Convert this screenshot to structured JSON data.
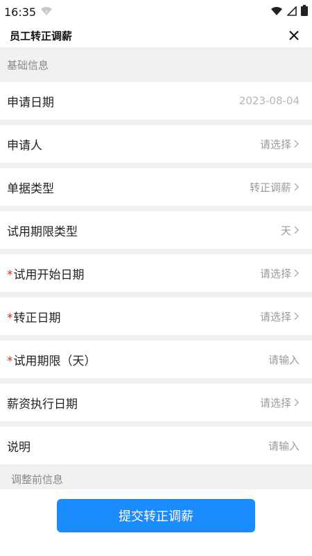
{
  "status_bar": {
    "time": "16:35",
    "icons": [
      "wifi-question-icon",
      "wifi-icon",
      "signal-icon",
      "battery-icon"
    ]
  },
  "header": {
    "title": "员工转正调薪",
    "close_icon": "close-icon"
  },
  "section_basic": {
    "title": "基础信息"
  },
  "fields": [
    {
      "label": "申请日期",
      "required": false,
      "value": "2023-08-04",
      "chevron": false
    },
    {
      "label": "申请人",
      "required": false,
      "value": "请选择",
      "chevron": true
    },
    {
      "label": "单据类型",
      "required": false,
      "value": "转正调薪",
      "chevron": true
    },
    {
      "label": "试用期限类型",
      "required": false,
      "value": "天",
      "chevron": true
    },
    {
      "label": "试用开始日期",
      "required": true,
      "value": "请选择",
      "chevron": true
    },
    {
      "label": "转正日期",
      "required": true,
      "value": "请选择",
      "chevron": true
    },
    {
      "label": "试用期限（天）",
      "required": true,
      "value": "请输入",
      "chevron": false
    },
    {
      "label": "薪资执行日期",
      "required": false,
      "value": "请选择",
      "chevron": true
    },
    {
      "label": "说明",
      "required": false,
      "value": "请输入",
      "chevron": false
    }
  ],
  "section_before": {
    "title": "调整前信息"
  },
  "submit": {
    "label": "提交转正调薪"
  },
  "colors": {
    "accent": "#1a8cff",
    "required": "#e02424",
    "section_bg": "#f1f1f3"
  }
}
